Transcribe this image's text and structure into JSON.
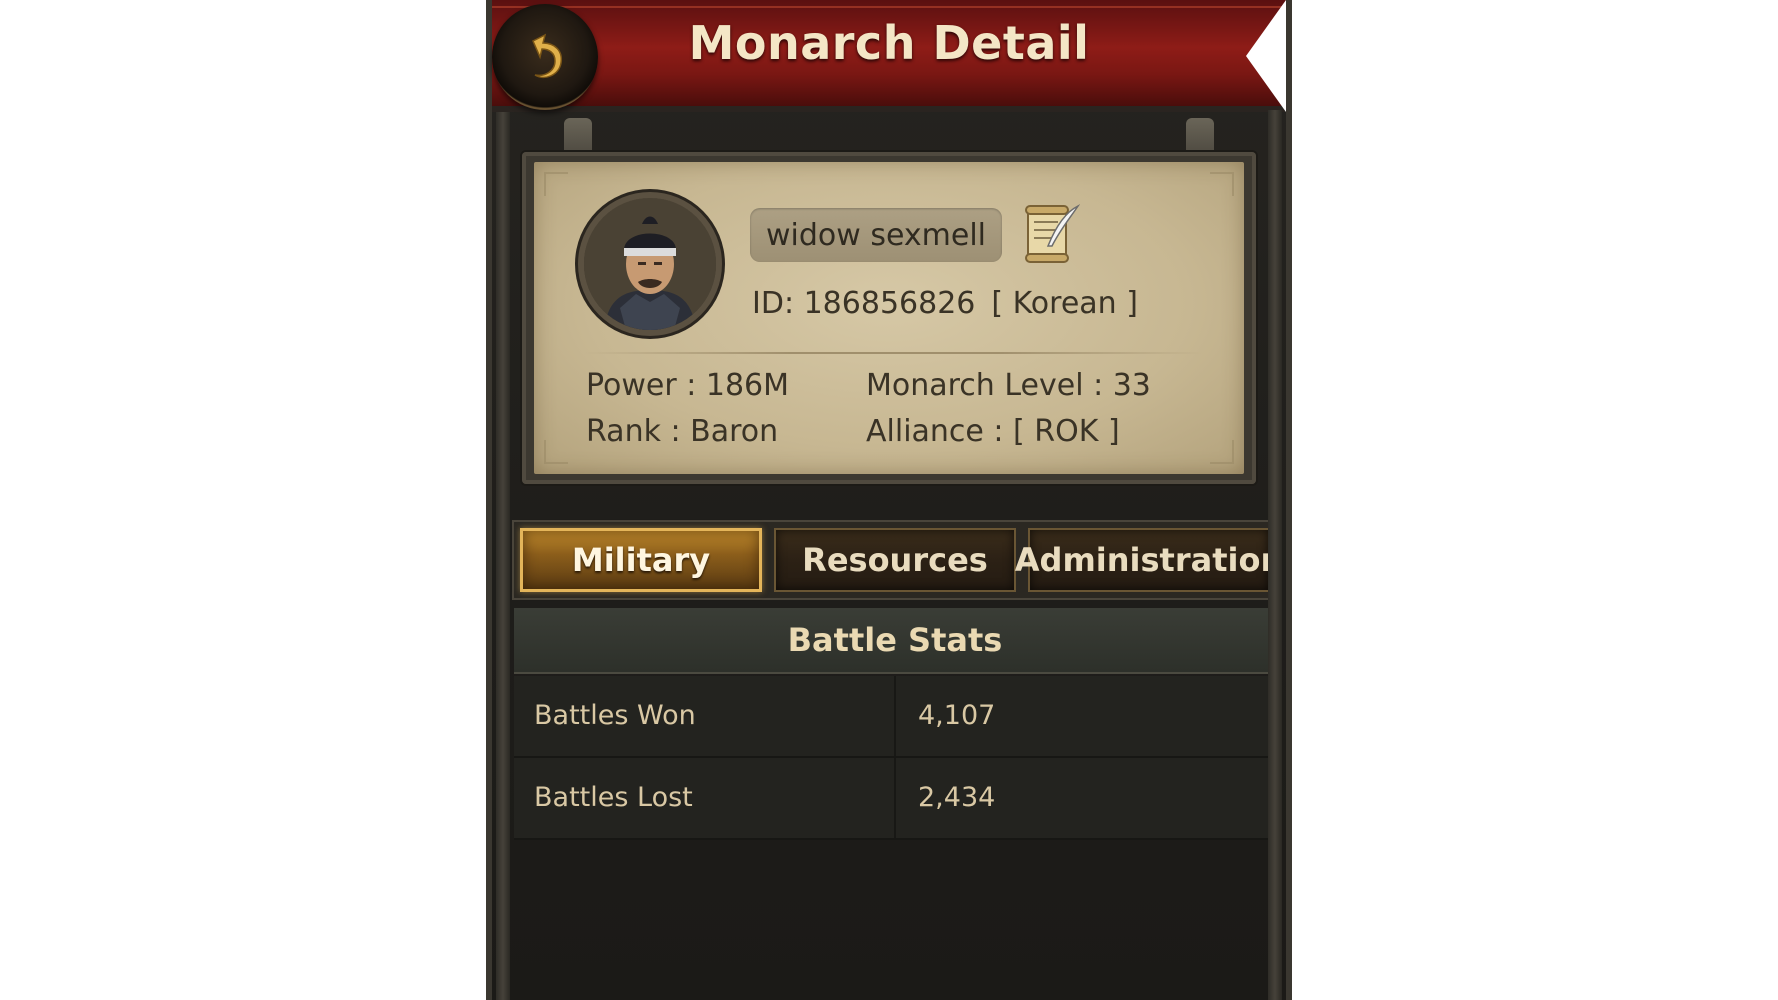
{
  "header": {
    "title": "Monarch Detail"
  },
  "profile": {
    "name": "widow sexmell",
    "id_label": "ID: 186856826",
    "language": "[ Korean ]",
    "power": "Power : 186M",
    "monarch_level": "Monarch Level : 33",
    "rank": "Rank : Baron",
    "alliance": "Alliance :  [ ROK ]"
  },
  "tabs": [
    {
      "label": "Military",
      "active": true
    },
    {
      "label": "Resources",
      "active": false
    },
    {
      "label": "Administration",
      "active": false
    }
  ],
  "battle_stats": {
    "title": "Battle Stats",
    "rows": [
      {
        "label": "Battles Won",
        "value": "4,107"
      },
      {
        "label": "Battles Lost",
        "value": "2,434"
      }
    ]
  },
  "icons": {
    "back": "back-arrow-icon",
    "edit": "scroll-quill-icon",
    "avatar": "monarch-portrait"
  },
  "colors": {
    "header_red": "#8e1c17",
    "parchment": "#c7b792",
    "tab_active_gold": "#c08a2c",
    "text_light": "#d9c8a4"
  }
}
